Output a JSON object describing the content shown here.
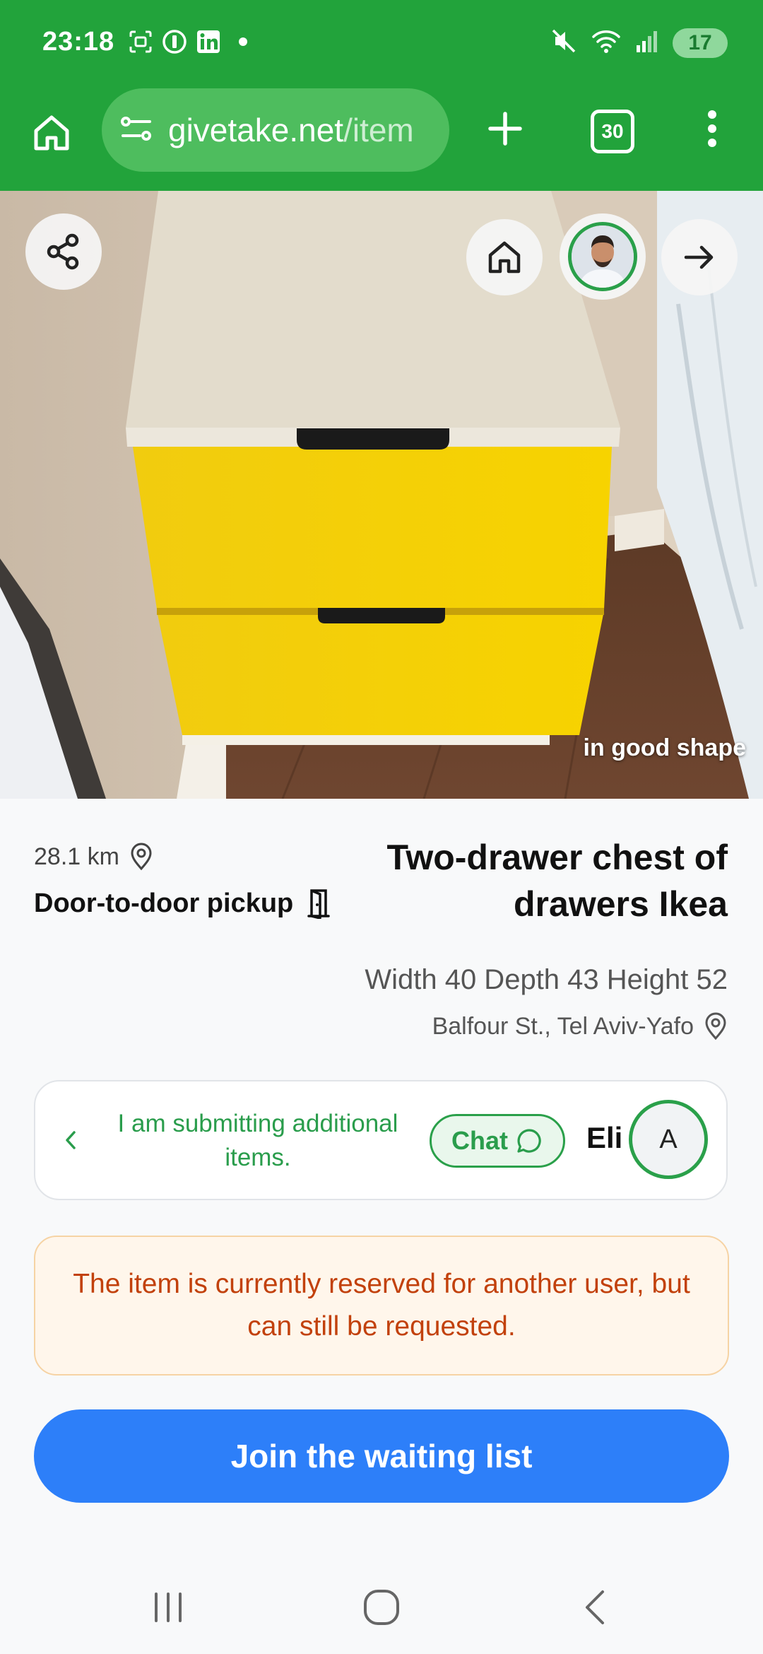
{
  "status_bar": {
    "time": "23:18",
    "battery": "17"
  },
  "browser": {
    "url_host": "givetake.net",
    "url_path": "/item",
    "tab_count": "30"
  },
  "item": {
    "image_caption": "in good shape",
    "distance": "28.1 km",
    "pickup": "Door-to-door pickup",
    "title": "Two-drawer chest of drawers Ikea",
    "dimensions": "Width 40 Depth 43 Height 52",
    "address": "Balfour St., Tel Aviv-Yafo"
  },
  "giver": {
    "message": "I am submitting additional items.",
    "chat_label": "Chat",
    "name": "Eli",
    "avatar_initial": "A"
  },
  "notice": {
    "text": "The item is currently reserved for another user, but can still be requested."
  },
  "cta": {
    "label": "Join the waiting list"
  },
  "colors": {
    "brand_green": "#22a33b",
    "accent_green": "#2aa04a",
    "cta_blue": "#2d7ff9",
    "notice_text": "#c2410c",
    "notice_bg": "#fff6eb"
  },
  "icons": {
    "status_left": [
      "screenshot-icon",
      "one-password-icon",
      "linkedin-icon"
    ],
    "status_right": [
      "mute-icon",
      "wifi-icon",
      "signal-icon",
      "battery-icon"
    ]
  }
}
